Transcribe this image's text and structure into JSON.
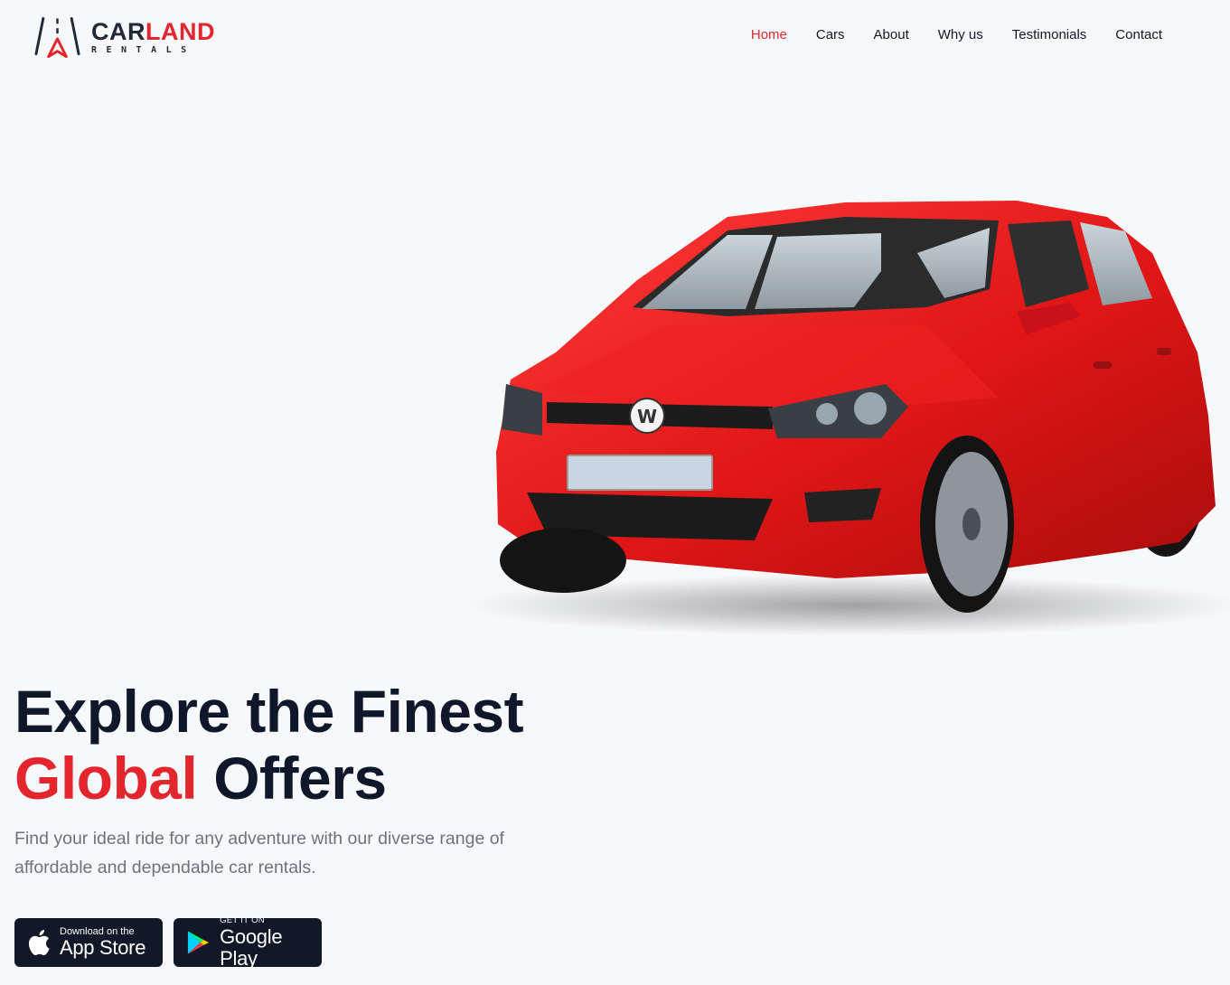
{
  "brand": {
    "name_part1": "CAR",
    "name_part2": "LAND",
    "tagline": "RENTALS",
    "accent_color": "#e3262d",
    "logo_icon": "road-arrow-icon"
  },
  "nav": {
    "items": [
      {
        "label": "Home",
        "active": true
      },
      {
        "label": "Cars",
        "active": false
      },
      {
        "label": "About",
        "active": false
      },
      {
        "label": "Why us",
        "active": false
      },
      {
        "label": "Testimonials",
        "active": false
      },
      {
        "label": "Contact",
        "active": false
      }
    ]
  },
  "hero": {
    "title_line1": "Explore the Finest",
    "title_accent": "Global",
    "title_rest": "Offers",
    "description": "Find your ideal ride for any adventure with our diverse range of affordable and dependable car rentals.",
    "car_image": "red-hatchback-car"
  },
  "stores": {
    "app_store": {
      "small": "Download on the",
      "big": "App Store",
      "icon": "apple-icon"
    },
    "google_play": {
      "small": "GET IT ON",
      "big": "Google Play",
      "icon": "google-play-icon"
    }
  }
}
